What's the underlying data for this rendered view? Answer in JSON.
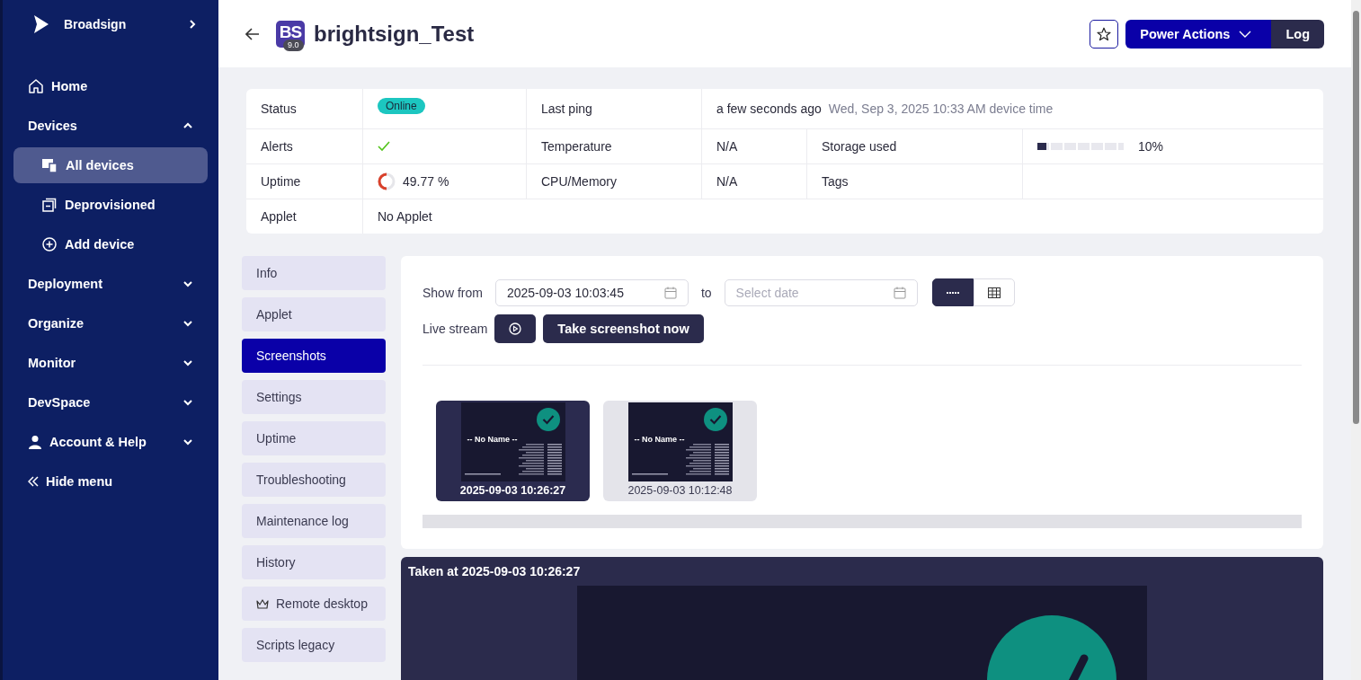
{
  "sidebar": {
    "brand": "Broadsign",
    "items": [
      {
        "kind": "link",
        "label": "Home"
      },
      {
        "kind": "group",
        "label": "Devices",
        "expanded": true,
        "children": [
          {
            "label": "All devices",
            "selected": true
          },
          {
            "label": "Deprovisioned",
            "selected": false
          },
          {
            "label": "Add device",
            "selected": false
          }
        ]
      },
      {
        "kind": "group",
        "label": "Deployment",
        "expanded": false
      },
      {
        "kind": "group",
        "label": "Organize",
        "expanded": false
      },
      {
        "kind": "group",
        "label": "Monitor",
        "expanded": false
      },
      {
        "kind": "group",
        "label": "DevSpace",
        "expanded": false
      },
      {
        "kind": "group",
        "label": "Account & Help",
        "expanded": false
      }
    ],
    "hide_menu": "Hide menu"
  },
  "header": {
    "badge": {
      "initials": "BS",
      "version": "9.0"
    },
    "title": "brightsign_Test",
    "favorite": false,
    "actions": [
      {
        "kind": "dropdown",
        "label": "Power Actions"
      },
      {
        "kind": "plain",
        "label": "Log"
      }
    ]
  },
  "info": {
    "rows": [
      [
        {
          "kind": "label",
          "text": "Status"
        },
        {
          "kind": "badge",
          "text": "Online"
        },
        {
          "kind": "label",
          "text": "Last ping"
        },
        {
          "kind": "ping",
          "text": "a few seconds ago",
          "detail": "Wed, Sep 3, 2025 10:33 AM device time"
        }
      ],
      [
        {
          "kind": "label",
          "text": "Alerts"
        },
        {
          "kind": "alert",
          "ok": true
        },
        {
          "kind": "label",
          "text": "Temperature"
        },
        {
          "kind": "text",
          "text": "N/A"
        },
        {
          "kind": "label",
          "text": "Storage used"
        },
        {
          "kind": "meter",
          "level": 0.1,
          "text": "10%"
        }
      ],
      [
        {
          "kind": "label",
          "text": "Uptime"
        },
        {
          "kind": "ring",
          "level": 0.4977,
          "text": "49.77 %"
        },
        {
          "kind": "label",
          "text": "CPU/Memory"
        },
        {
          "kind": "text",
          "text": "N/A"
        },
        {
          "kind": "label",
          "text": "Tags"
        },
        {
          "kind": "empty"
        }
      ],
      [
        {
          "kind": "label",
          "text": "Applet"
        },
        {
          "kind": "text",
          "text": "No Applet"
        }
      ]
    ]
  },
  "tabs": [
    {
      "label": "Info",
      "selected": false
    },
    {
      "label": "Applet",
      "selected": false
    },
    {
      "label": "Screenshots",
      "selected": true
    },
    {
      "label": "Settings",
      "selected": false
    },
    {
      "label": "Uptime",
      "selected": false
    },
    {
      "label": "Troubleshooting",
      "selected": false
    },
    {
      "label": "Maintenance log",
      "selected": false
    },
    {
      "label": "History",
      "selected": false
    },
    {
      "label": "Remote desktop",
      "selected": false,
      "kind": "icon"
    },
    {
      "label": "Scripts legacy",
      "selected": false
    }
  ],
  "screenshots": {
    "show_from_label": "Show from",
    "from_value": "2025-09-03 10:03:45",
    "to_label": "to",
    "to_placeholder": "Select date",
    "view_modes": [
      {
        "kind": "timeline",
        "selected": true
      },
      {
        "kind": "grid",
        "selected": false
      }
    ],
    "live_stream_label": "Live stream",
    "take_button": "Take screenshot now",
    "thumbnails": [
      {
        "screen_title": "-- No Name --",
        "timestamp": "2025-09-03 10:26:27",
        "selected": true,
        "verified": true
      },
      {
        "screen_title": "-- No Name --",
        "timestamp": "2025-09-03 10:12:48",
        "selected": false,
        "verified": true
      }
    ]
  },
  "preview": {
    "title": "Taken at 2025-09-03 10:26:27",
    "verified": true
  }
}
